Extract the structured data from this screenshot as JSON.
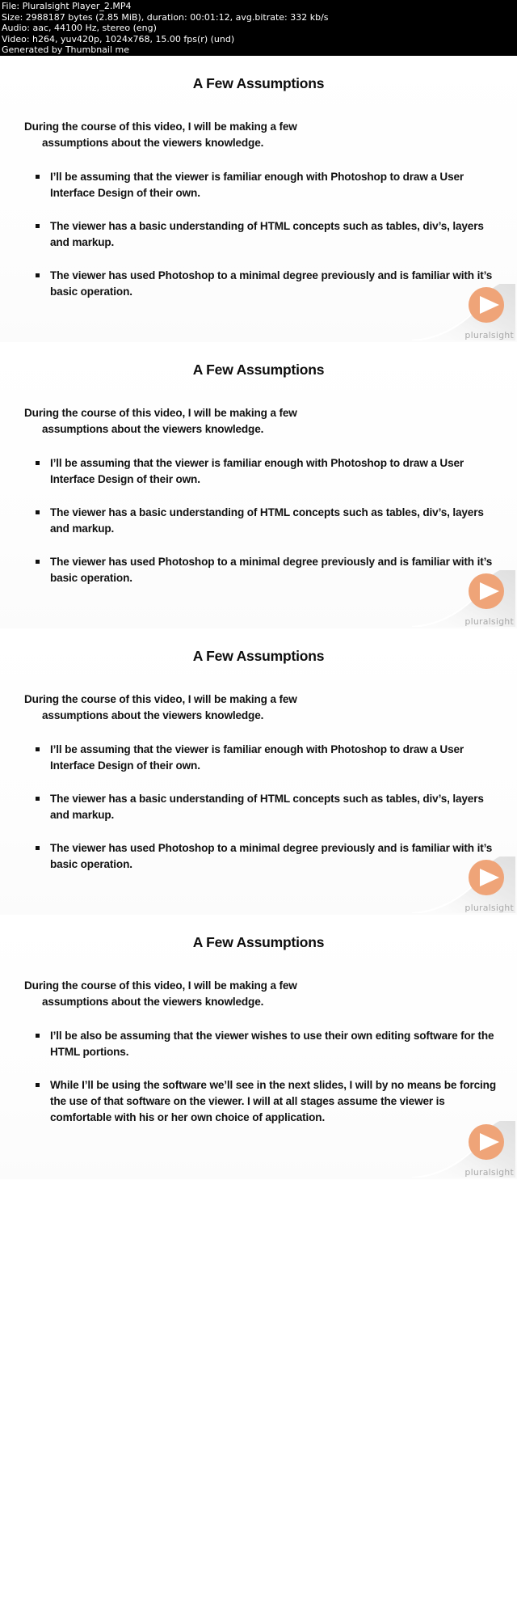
{
  "header": {
    "lines": [
      "File: Pluralsight Player_2.MP4",
      "Size: 2988187 bytes (2.85 MiB), duration: 00:01:12, avg.bitrate: 332 kb/s",
      "Audio: aac, 44100 Hz, stereo (eng)",
      "Video: h264, yuv420p, 1024x768, 15.00 fps(r) (und)",
      "Generated by Thumbnail me"
    ],
    "file": "File: Pluralsight Player_2.MP4",
    "size": "Size: 2988187 bytes (2.85 MiB), duration: 00:01:12, avg.bitrate: 332 kb/s",
    "audio": "Audio: aac, 44100 Hz, stereo (eng)",
    "video": "Video: h264, yuv420p, 1024x768, 15.00 fps(r) (und)",
    "generator": "Generated by Thumbnail me"
  },
  "brand": {
    "wordmark": "pluralsight",
    "circle_color": "#EFA478",
    "wordmark_color": "#a9a9a9"
  },
  "slides": [
    {
      "title": "A Few Assumptions",
      "lead_line1": "During the course of this video, I will be making a few",
      "lead_line2": "assumptions about the viewers knowledge.",
      "bullets": [
        "I’ll be assuming that the viewer is familiar enough with Photoshop to draw a User Interface Design of their own.",
        "The viewer has a basic understanding of HTML concepts such as tables, div’s, layers and markup.",
        "The viewer has used Photoshop to a minimal degree previously and is familiar with it’s basic operation."
      ]
    },
    {
      "title": "A Few Assumptions",
      "lead_line1": "During the course of this video, I will be making a few",
      "lead_line2": "assumptions about the viewers knowledge.",
      "bullets": [
        "I’ll be assuming that the viewer is familiar enough with Photoshop to draw a User Interface Design of their own.",
        "The viewer has a basic understanding of HTML concepts such as tables, div’s, layers and markup.",
        "The viewer has used Photoshop to a minimal degree previously and is familiar with it’s basic operation."
      ]
    },
    {
      "title": "A Few Assumptions",
      "lead_line1": "During the course of this video, I will be making a few",
      "lead_line2": "assumptions about the viewers knowledge.",
      "bullets": [
        "I’ll be assuming that the viewer is familiar enough with Photoshop to draw a User Interface Design of their own.",
        "The viewer has a basic understanding of HTML concepts such as tables, div’s, layers and markup.",
        "The viewer has used Photoshop to a minimal degree previously and is familiar with it’s basic operation."
      ]
    },
    {
      "title": "A Few Assumptions",
      "lead_line1": "During the course of this video, I will be making a few",
      "lead_line2": "assumptions about the viewers knowledge.",
      "bullets": [
        "I’ll be also be assuming that the viewer wishes to use their own editing software for the HTML portions.",
        "While I’ll be using the software we’ll see in the next slides, I will by no means be forcing the use of that software on the viewer.  I will at all stages assume the viewer is comfortable with his or her own choice of application."
      ]
    }
  ]
}
